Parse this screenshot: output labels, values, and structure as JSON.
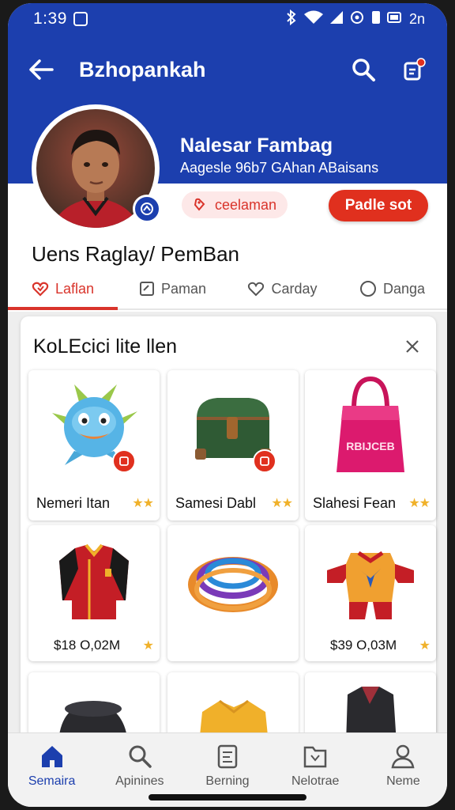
{
  "status_bar": {
    "time": "1:39",
    "right_text": "2n"
  },
  "app_bar": {
    "title": "Bzhopankah"
  },
  "profile": {
    "name": "Nalesar Fambag",
    "subtitle": "Aagesle 96b7 GAhan ABaisans",
    "chip_label": "ceelaman",
    "action_button": "Padle sot",
    "title": "Uens Raglay/ PemBan"
  },
  "tabs": [
    {
      "label": "Laflan",
      "icon": "heart-icon",
      "active": true
    },
    {
      "label": "Paman",
      "icon": "checkbox-icon",
      "active": false
    },
    {
      "label": "Carday",
      "icon": "heart-outline-icon",
      "active": false
    },
    {
      "label": "Danga",
      "icon": "circle-icon",
      "active": false
    }
  ],
  "collection": {
    "title": "KoLEcici lite llen",
    "items": [
      {
        "label": "Nemeri Itan",
        "stars": "★★",
        "image": "creature-toy"
      },
      {
        "label": "Samesi Dabl",
        "stars": "★★",
        "image": "green-chest"
      },
      {
        "label": "Slahesi Fean",
        "stars": "★★",
        "image": "pink-bag",
        "bag_text": "RBIJCEB"
      },
      {
        "price": "$18 O,02M",
        "stars": "★",
        "image": "red-jersey"
      },
      {
        "price": "",
        "stars": "",
        "image": "rope-coil"
      },
      {
        "price": "$39 O,03M",
        "stars": "★",
        "image": "mascot-costume"
      }
    ]
  },
  "bottom_nav": [
    {
      "label": "Semaira",
      "icon": "home-icon",
      "active": true
    },
    {
      "label": "Apinines",
      "icon": "search-icon",
      "active": false
    },
    {
      "label": "Berning",
      "icon": "clipboard-icon",
      "active": false
    },
    {
      "label": "Nelotrae",
      "icon": "folder-icon",
      "active": false
    },
    {
      "label": "Neme",
      "icon": "person-icon",
      "active": false
    }
  ],
  "colors": {
    "brand": "#1c3fae",
    "accent": "#e0301e",
    "star": "#f0b12a"
  }
}
